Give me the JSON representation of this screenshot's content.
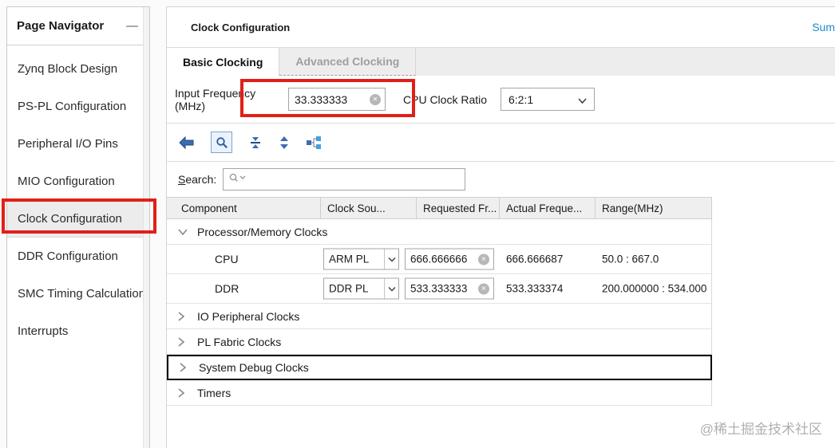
{
  "icons": {
    "clear": "✕",
    "minimize": "—"
  },
  "watermark": "@稀土掘金技术社区",
  "sidebar": {
    "title": "Page Navigator",
    "items": [
      {
        "label": "Zynq Block Design"
      },
      {
        "label": "PS-PL Configuration"
      },
      {
        "label": "Peripheral I/O Pins"
      },
      {
        "label": "MIO Configuration"
      },
      {
        "label": "Clock Configuration",
        "selected": true
      },
      {
        "label": "DDR Configuration"
      },
      {
        "label": "SMC Timing Calculation"
      },
      {
        "label": "Interrupts"
      }
    ]
  },
  "main": {
    "title": "Clock Configuration",
    "summary_link": "Sum",
    "tabs": [
      {
        "label": "Basic Clocking",
        "active": true
      },
      {
        "label": "Advanced Clocking",
        "active": false
      }
    ],
    "controls": {
      "input_frequency_label": "Input Frequency (MHz)",
      "input_frequency_value": "33.333333",
      "cpu_clock_ratio_label": "CPU Clock Ratio",
      "cpu_clock_ratio_value": "6:2:1"
    },
    "search": {
      "label_key": "S",
      "label_rest": "earch:",
      "value": ""
    },
    "table": {
      "columns": [
        "Component",
        "Clock Sou...",
        "Requested Fr...",
        "Actual Freque...",
        "Range(MHz)"
      ],
      "rows": [
        {
          "type": "group-expanded",
          "label": "Processor/Memory Clocks"
        },
        {
          "type": "data",
          "label": "CPU",
          "source": "ARM PL",
          "requested": "666.666666",
          "actual": "666.666687",
          "range": "50.0 : 667.0"
        },
        {
          "type": "data",
          "label": "DDR",
          "source": "DDR PL",
          "requested": "533.333333",
          "actual": "533.333374",
          "range": "200.000000 : 534.000"
        },
        {
          "type": "group-collapsed",
          "label": "IO Peripheral Clocks"
        },
        {
          "type": "group-collapsed",
          "label": "PL Fabric Clocks"
        },
        {
          "type": "group-collapsed",
          "label": "System Debug Clocks",
          "focused": true
        },
        {
          "type": "group-collapsed",
          "label": "Timers"
        }
      ]
    }
  }
}
